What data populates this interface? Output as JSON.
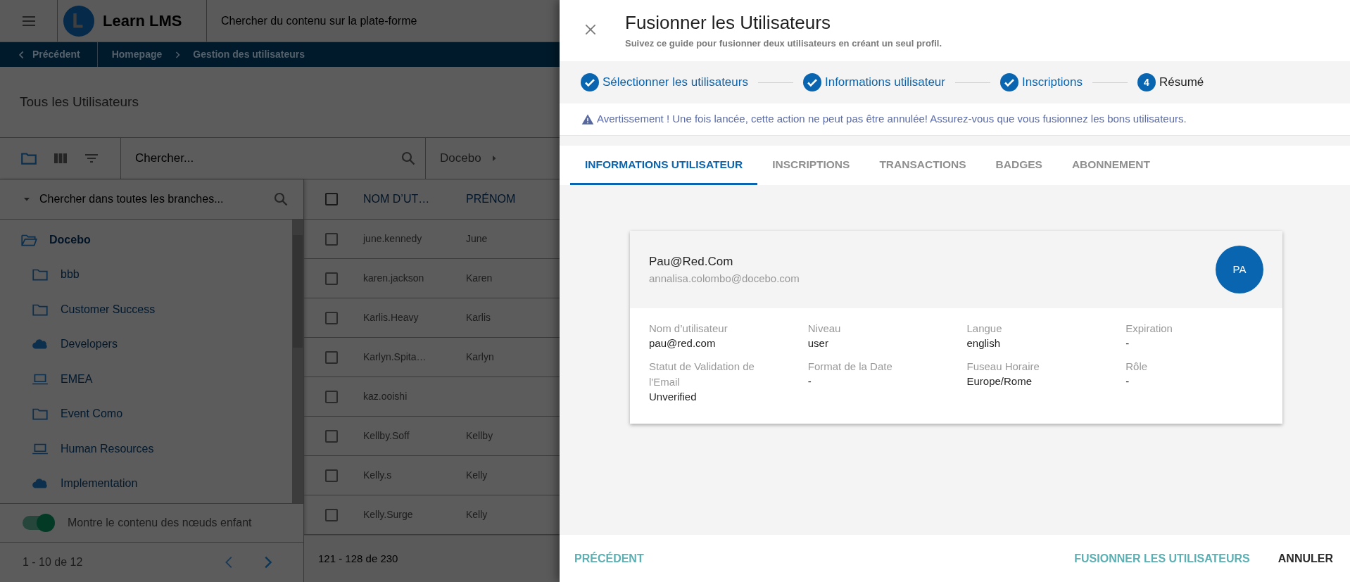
{
  "topbar": {
    "app_name": "Learn LMS",
    "search_placeholder": "Chercher du contenu sur la plate-forme"
  },
  "breadcrumb": {
    "back": "Précédent",
    "items": [
      "Homepage",
      "Gestion des utilisateurs"
    ]
  },
  "page_title": "Tous les Utilisateurs",
  "toolbar": {
    "search_placeholder": "Chercher...",
    "branch": "Docebo"
  },
  "tree": {
    "search_placeholder": "Chercher dans toutes les branches...",
    "items": [
      {
        "label": "Docebo",
        "kind": "folder-open",
        "selected": true
      },
      {
        "label": "bbb",
        "kind": "folder",
        "selected": false
      },
      {
        "label": "Customer Success",
        "kind": "folder",
        "selected": false
      },
      {
        "label": "Developers",
        "kind": "cloud",
        "selected": false
      },
      {
        "label": "EMEA",
        "kind": "laptop",
        "selected": false
      },
      {
        "label": "Event Como",
        "kind": "folder",
        "selected": false
      },
      {
        "label": "Human Resources",
        "kind": "laptop",
        "selected": false
      },
      {
        "label": "Implementation",
        "kind": "cloud",
        "selected": false
      }
    ],
    "toggle": {
      "label": "Montre le contenu des nœuds enfant",
      "on": true
    },
    "pagination": "1 - 10 de 12"
  },
  "table": {
    "header_checked": false,
    "columns": [
      "NOM D’UT…",
      "PRÉNOM"
    ],
    "rows": [
      {
        "cells": [
          "june.kennedy",
          "June"
        ],
        "checked": false
      },
      {
        "cells": [
          "karen.jackson",
          "Karen"
        ],
        "checked": false
      },
      {
        "cells": [
          "Karlis.Heavy",
          "Karlis"
        ],
        "checked": false
      },
      {
        "cells": [
          "Karlyn.Spita…",
          "Karlyn"
        ],
        "checked": false
      },
      {
        "cells": [
          "kaz.ooishi",
          ""
        ],
        "checked": false
      },
      {
        "cells": [
          "Kellby.Soff",
          "Kellby"
        ],
        "checked": false
      },
      {
        "cells": [
          "Kelly.s",
          "Kelly"
        ],
        "checked": false
      },
      {
        "cells": [
          "Kelly.Surge",
          "Kelly"
        ],
        "checked": false
      }
    ],
    "pagination": "121 - 128 de 230"
  },
  "dialog": {
    "title": "Fusionner les Utilisateurs",
    "subtitle": "Suivez ce guide pour fusionner deux utilisateurs en créant un seul profil.",
    "steps": [
      {
        "label": "Sélectionner les utilisateurs",
        "done": true
      },
      {
        "label": "Informations utilisateur",
        "done": true
      },
      {
        "label": "Inscriptions",
        "done": true
      },
      {
        "label": "Résumé",
        "done": false,
        "number": "4"
      }
    ],
    "warning": "Avertissement ! Une fois lancée, cette action ne peut pas être annulée! Assurez-vous que vous fusionnez les bons utilisateurs.",
    "tabs": [
      {
        "label": "INFORMATIONS UTILISATEUR",
        "selected": true
      },
      {
        "label": "INSCRIPTIONS",
        "selected": false
      },
      {
        "label": "TRANSACTIONS",
        "selected": false
      },
      {
        "label": "BADGES",
        "selected": false
      },
      {
        "label": "ABONNEMENT",
        "selected": false
      }
    ],
    "card": {
      "name": "Pau@Red.Com",
      "email": "annalisa.colombo@docebo.com",
      "initials": "PA",
      "fields": [
        {
          "label": "Nom d’utilisateur",
          "value": "pau@red.com"
        },
        {
          "label": "Niveau",
          "value": "user"
        },
        {
          "label": "Langue",
          "value": "english"
        },
        {
          "label": "Expiration",
          "value": "-"
        },
        {
          "label": "Statut de Validation de l'Email",
          "value": "Unverified"
        },
        {
          "label": "Format de la Date",
          "value": "-"
        },
        {
          "label": "Fuseau Horaire",
          "value": "Europe/Rome"
        },
        {
          "label": "Rôle",
          "value": "-"
        }
      ]
    },
    "footer": {
      "back": "PRÉCÉDENT",
      "merge": "FUSIONNER LES UTILISATEURS",
      "cancel": "ANNULER"
    }
  }
}
